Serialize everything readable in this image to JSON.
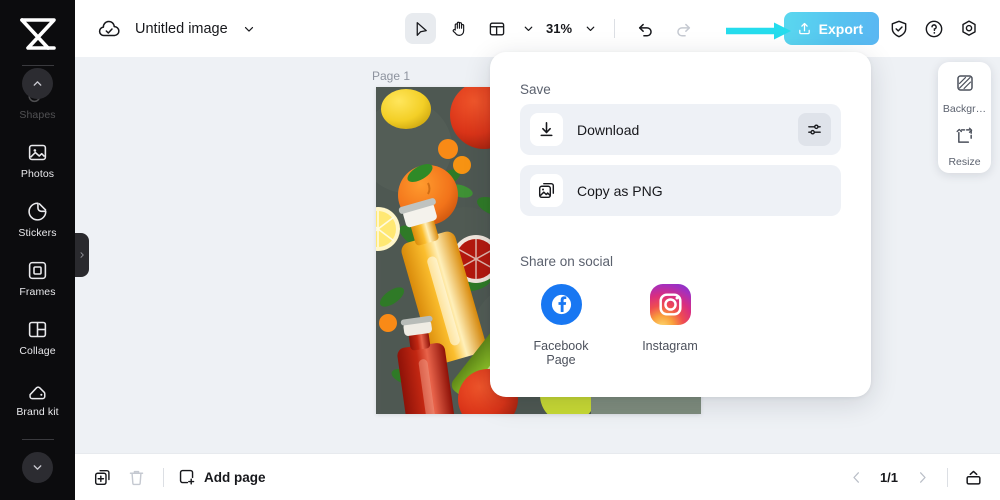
{
  "sidebar": {
    "logo": "app-logo",
    "items": [
      {
        "label": "Shapes",
        "icon": "shapes-icon",
        "state": "dimmed"
      },
      {
        "label": "Photos",
        "icon": "photos-icon",
        "state": "normal"
      },
      {
        "label": "Stickers",
        "icon": "stickers-icon",
        "state": "normal"
      },
      {
        "label": "Frames",
        "icon": "frames-icon",
        "state": "normal"
      },
      {
        "label": "Collage",
        "icon": "collage-icon",
        "state": "normal"
      },
      {
        "label": "Brand kit",
        "icon": "brandkit-icon",
        "state": "normal"
      }
    ],
    "scroll_up": "chevron-up-icon",
    "scroll_down": "chevron-down-icon",
    "collapse_handle": "chevron-right-icon"
  },
  "topbar": {
    "cloud_icon": "cloud-check-icon",
    "title": "Untitled image",
    "title_chevron": "chevron-down-icon",
    "tools": [
      {
        "name": "select-tool",
        "icon": "cursor-arrow-icon",
        "active": true
      },
      {
        "name": "hand-tool",
        "icon": "hand-icon",
        "active": false
      },
      {
        "name": "layout-tool",
        "icon": "layout-icon",
        "active": false
      }
    ],
    "layout_chevron": "chevron-down-icon",
    "zoom": "31%",
    "zoom_chevron": "chevron-down-icon",
    "undo": "undo-icon",
    "redo": "redo-icon",
    "export_label": "Export",
    "export_icon": "upload-icon",
    "shield_icon": "shield-check-icon",
    "help_icon": "help-circle-icon",
    "settings_icon": "gear-icon",
    "annotation_arrow_color": "#25dced"
  },
  "canvas": {
    "page_label": "Page 1",
    "background_color": "#7e8c7d",
    "photo_alt": "citrus-fruit-and-juice-bottles-photo"
  },
  "export_panel": {
    "save_heading": "Save",
    "rows": [
      {
        "label": "Download",
        "icon": "download-icon",
        "settings_icon": "sliders-icon"
      },
      {
        "label": "Copy as PNG",
        "icon": "copy-image-icon",
        "settings_icon": null
      }
    ],
    "social_heading": "Share on social",
    "social": [
      {
        "label": "Facebook\nPage",
        "label_line1": "Facebook",
        "label_line2": "Page",
        "icon": "facebook-icon",
        "color": "#1877f2"
      },
      {
        "label": "Instagram",
        "label_line1": "Instagram",
        "label_line2": "",
        "icon": "instagram-icon",
        "color": "#e1306c"
      }
    ]
  },
  "right_panel": {
    "items": [
      {
        "label": "Backgr…",
        "icon": "background-icon"
      },
      {
        "label": "Resize",
        "icon": "resize-icon"
      }
    ]
  },
  "bottombar": {
    "duplicate_icon": "duplicate-page-icon",
    "delete_icon": "trash-icon",
    "add_page_label": "Add page",
    "add_page_icon": "square-plus-icon",
    "prev_icon": "chevron-left-icon",
    "page_count": "1/1",
    "next_icon": "chevron-right-icon",
    "panel_icon": "page-panel-icon"
  }
}
